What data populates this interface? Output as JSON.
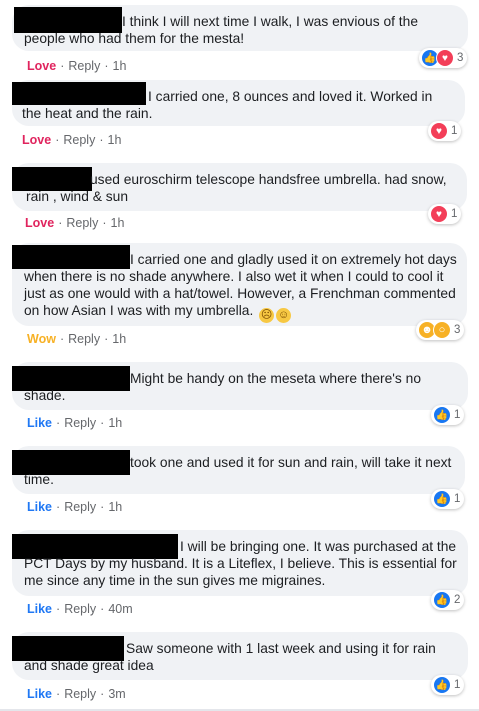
{
  "comments": [
    {
      "text": "I think I will next time I walk, I was envious of the people who had them for the mesta!",
      "reaction": "Love",
      "reply": "Reply",
      "time": "1h",
      "count": "3"
    },
    {
      "text": "I carried one, 8 ounces and loved it. Worked in the heat and the rain.",
      "reaction": "Love",
      "reply": "Reply",
      "time": "1h",
      "count": "1"
    },
    {
      "text": "used euroschirm telescope handsfree umbrella. had snow, rain , wind & sun",
      "reaction": "Love",
      "reply": "Reply",
      "time": "1h",
      "count": "1"
    },
    {
      "text": "I carried one and gladly used it on extremely hot days when there is no shade anywhere. I also wet it when I could to cool it just as one would with a hat/towel. However, a Frenchman commented on how Asian I was with my umbrella.",
      "reaction": "Wow",
      "reply": "Reply",
      "time": "1h",
      "count": "3"
    },
    {
      "text": "Might be handy on the meseta where there's no shade.",
      "reaction": "Like",
      "reply": "Reply",
      "time": "1h",
      "count": "1"
    },
    {
      "text": "took one and used it for sun and rain, will take it next time.",
      "reaction": "Like",
      "reply": "Reply",
      "time": "1h",
      "count": "1"
    },
    {
      "text": "I will be bringing one. It was purchased at the PCT Days by my husband. It is a Liteflex, I believe. This is essential for me since any time in the sun gives me migraines.",
      "reaction": "Like",
      "reply": "Reply",
      "time": "40m",
      "count": "2"
    },
    {
      "text": "Saw someone with 1 last week and using it for rain and shade great idea",
      "reaction": "Like",
      "reply": "Reply",
      "time": "3m",
      "count": "1"
    }
  ],
  "separator": "·",
  "colors": {
    "love": "#e0245e",
    "wow": "#f7b125",
    "like": "#2078f4",
    "bubble": "#f0f2f5"
  }
}
